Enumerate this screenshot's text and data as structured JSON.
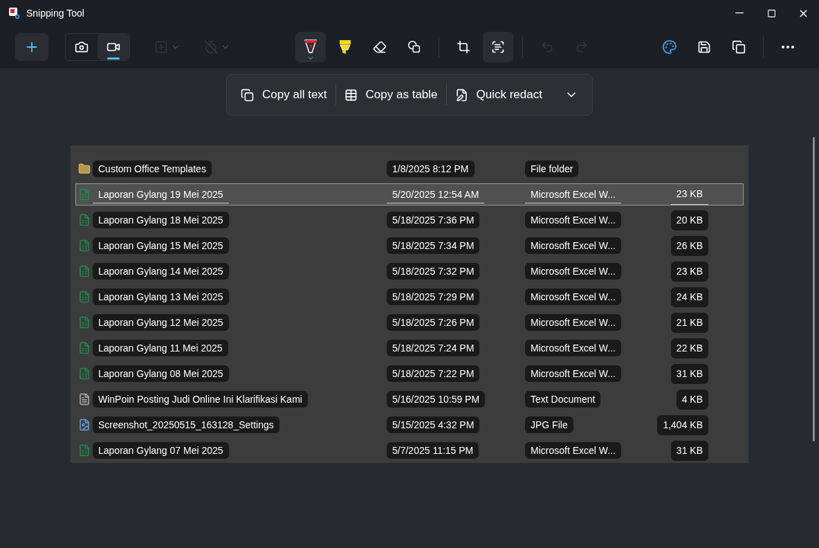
{
  "window": {
    "title": "Snipping Tool"
  },
  "toolbar": {
    "new_button": {
      "kind": "new"
    },
    "mode": [
      {
        "kind": "photo",
        "selected": false
      },
      {
        "kind": "video",
        "selected": true
      }
    ],
    "tools": [
      {
        "kind": "snip-shape",
        "disabled": true,
        "selected": false
      },
      {
        "kind": "delay",
        "disabled": true,
        "selected": false
      },
      {
        "kind": "pen",
        "disabled": false,
        "selected": true
      },
      {
        "kind": "highlighter",
        "disabled": false,
        "selected": false
      },
      {
        "kind": "eraser",
        "disabled": false,
        "selected": false
      },
      {
        "kind": "shapes",
        "disabled": false,
        "selected": false
      },
      {
        "kind": "crop",
        "disabled": false,
        "selected": false
      },
      {
        "kind": "text-actions",
        "disabled": false,
        "selected": true
      },
      {
        "kind": "undo",
        "disabled": true,
        "selected": false
      },
      {
        "kind": "redo",
        "disabled": true,
        "selected": false
      },
      {
        "kind": "paint",
        "disabled": false,
        "selected": false
      },
      {
        "kind": "save",
        "disabled": false,
        "selected": false
      },
      {
        "kind": "copy",
        "disabled": false,
        "selected": false
      },
      {
        "kind": "more",
        "disabled": false,
        "selected": false
      }
    ]
  },
  "text_actions": [
    {
      "kind": "copy",
      "label": "Copy all text"
    },
    {
      "kind": "table",
      "label": "Copy as table"
    },
    {
      "kind": "redact",
      "label": "Quick redact"
    }
  ],
  "capture": {
    "rows": [
      {
        "kind": "folder",
        "name": "Custom Office Templates",
        "date": "1/8/2025 8:12 PM",
        "type": "File folder",
        "selected": false
      },
      {
        "kind": "excel",
        "name": "Laporan Gylang 19 Mei 2025",
        "date": "5/20/2025 12:54 AM",
        "type": "Microsoft Excel W...",
        "size": "23 KB",
        "selected": true
      },
      {
        "kind": "excel",
        "name": "Laporan Gylang 18 Mei 2025",
        "date": "5/18/2025 7:36 PM",
        "type": "Microsoft Excel W...",
        "size": "20 KB",
        "selected": false
      },
      {
        "kind": "excel",
        "name": "Laporan Gylang 15 Mei 2025",
        "date": "5/18/2025 7:34 PM",
        "type": "Microsoft Excel W...",
        "size": "26 KB",
        "selected": false
      },
      {
        "kind": "excel",
        "name": "Laporan Gylang 14 Mei 2025",
        "date": "5/18/2025 7:32 PM",
        "type": "Microsoft Excel W...",
        "size": "23 KB",
        "selected": false
      },
      {
        "kind": "excel",
        "name": "Laporan Gylang 13 Mei 2025",
        "date": "5/18/2025 7:29 PM",
        "type": "Microsoft Excel W...",
        "size": "24 KB",
        "selected": false
      },
      {
        "kind": "excel",
        "name": "Laporan Gylang 12 Mei 2025",
        "date": "5/18/2025 7:26 PM",
        "type": "Microsoft Excel W...",
        "size": "21 KB",
        "selected": false
      },
      {
        "kind": "excel",
        "name": "Laporan Gylang 11 Mei 2025",
        "date": "5/18/2025 7:24 PM",
        "type": "Microsoft Excel W...",
        "size": "22 KB",
        "selected": false
      },
      {
        "kind": "excel",
        "name": "Laporan Gylang 08 Mei 2025",
        "date": "5/18/2025 7:22 PM",
        "type": "Microsoft Excel W...",
        "size": "31 KB",
        "selected": false
      },
      {
        "kind": "text",
        "name": "WinPoin Posting Judi Online Ini Klarifikasi Kami",
        "date": "5/16/2025 10:59 PM",
        "type": "Text Document",
        "size": "4 KB",
        "selected": false
      },
      {
        "kind": "image",
        "name": "Screenshot_20250515_163128_Settings",
        "date": "5/15/2025 4:32 PM",
        "type": "JPG File",
        "size": "1,404 KB",
        "selected": false
      },
      {
        "kind": "excel",
        "name": "Laporan Gylang 07 Mei 2025",
        "date": "5/7/2025 11:15 PM",
        "type": "Microsoft Excel W...",
        "size": "31 KB",
        "selected": false
      }
    ]
  }
}
